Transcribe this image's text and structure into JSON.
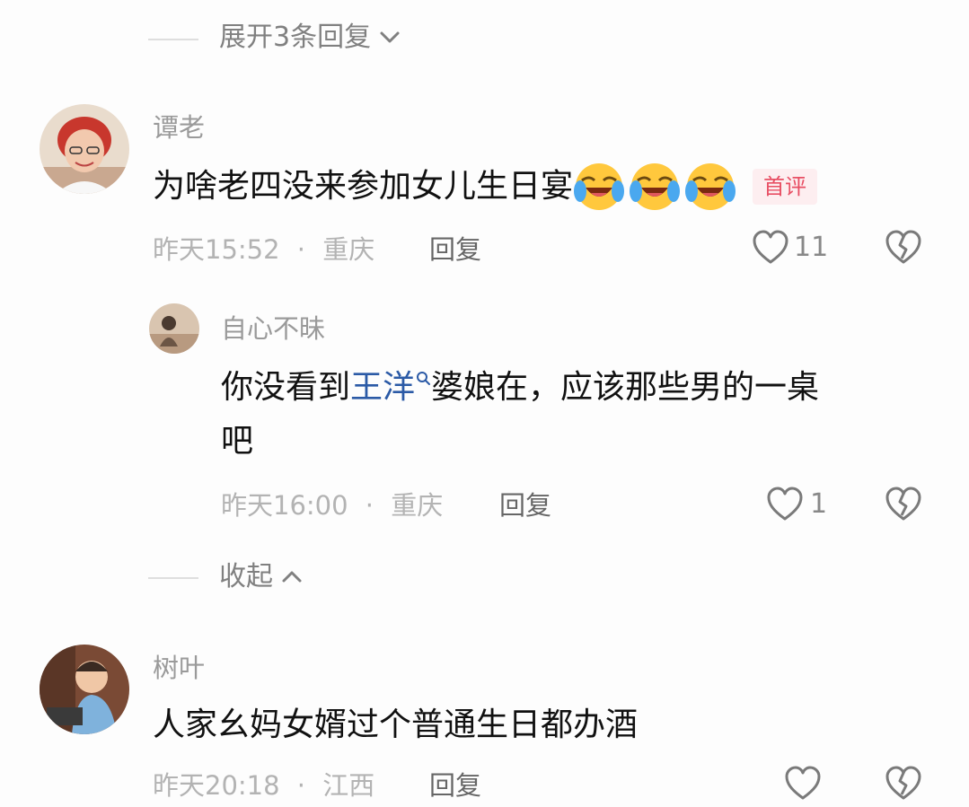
{
  "thread_top": {
    "expand_label": "展开3条回复"
  },
  "comment1": {
    "username": "谭老",
    "text": "为啥老四没来参加女儿生日宴",
    "emojis": [
      "tears-of-joy-emoji",
      "tears-of-joy-emoji",
      "tears-of-joy-emoji"
    ],
    "badge": "首评",
    "time": "昨天15:52",
    "separator": "·",
    "location": "重庆",
    "reply": "回复",
    "likes": "11"
  },
  "reply1": {
    "username": "自心不昧",
    "text_before": "你没看到",
    "mention": "王洋",
    "text_after": "婆娘在，应该那些男的一桌",
    "text_line2": "吧",
    "time": "昨天16:00",
    "separator": "·",
    "location": "重庆",
    "reply": "回复",
    "likes": "1"
  },
  "thread_collapse": {
    "label": "收起"
  },
  "comment2": {
    "username": "树叶",
    "text": "人家幺妈女婿过个普通生日都办酒",
    "time": "昨天20:18",
    "separator": "·",
    "location": "江西",
    "reply": "回复"
  },
  "colors": {
    "mention": "#2b5aa6",
    "badge_text": "#e84f64",
    "badge_bg": "#fdeef0",
    "muted": "#b3b3b3"
  }
}
